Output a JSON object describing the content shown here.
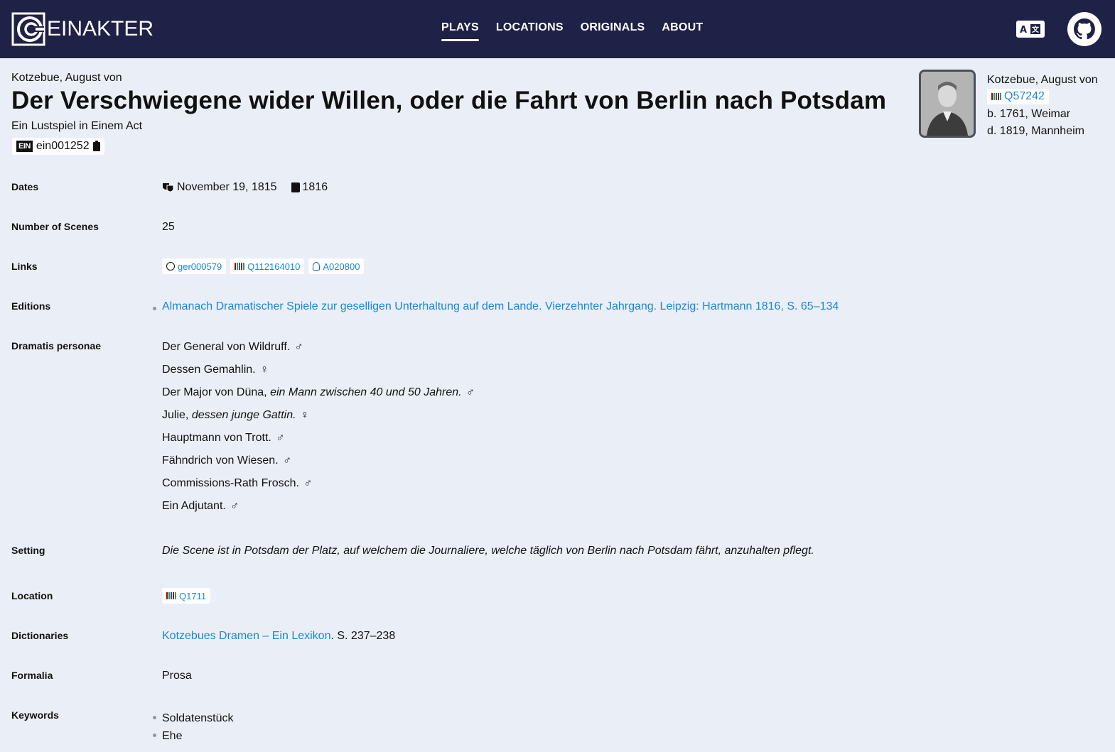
{
  "header": {
    "logo_text": "EINAKTER",
    "nav": [
      {
        "label": "PLAYS",
        "active": true
      },
      {
        "label": "LOCATIONS",
        "active": false
      },
      {
        "label": "ORIGINALS",
        "active": false
      },
      {
        "label": "ABOUT",
        "active": false
      }
    ],
    "icons": [
      "translate-icon",
      "github-icon"
    ],
    "colors": {
      "bar": "#1f2146",
      "link": "#1b86d9",
      "background": "#eaeff7"
    }
  },
  "play": {
    "author": "Kotzebue, August von",
    "title": "Der Verschwiegene wider Willen, oder die Fahrt von Berlin nach Potsdam",
    "subtitle": "Ein Lustspiel in Einem Act",
    "id_icon": "EIN",
    "id": "ein001252"
  },
  "author_card": {
    "name": "Kotzebue, August von",
    "wikidata": "Q57242",
    "born": "b. 1761, Weimar",
    "died": "d. 1819, Mannheim"
  },
  "details": {
    "dates": {
      "label": "Dates",
      "premiere": "November 19, 1815",
      "print": "1816"
    },
    "scenes": {
      "label": "Number of Scenes",
      "value": "25"
    },
    "links": {
      "label": "Links",
      "dracor": "ger000579",
      "wikidata": "Q112164010",
      "gnd": "A020800"
    },
    "editions": {
      "label": "Editions",
      "items": [
        "Almanach Dramatischer Spiele zur geselligen Unterhaltung auf dem Lande. Vierzehnter Jahrgang. Leipzig: Hartmann 1816, S. 65–134"
      ]
    },
    "dramatis": {
      "label": "Dramatis personae",
      "cast": [
        {
          "name": "Der General von Wildruff.",
          "desc": "",
          "gender": "♂"
        },
        {
          "name": "Dessen Gemahlin.",
          "desc": "",
          "gender": "♀"
        },
        {
          "name": "Der Major von Düna,",
          "desc": "ein Mann zwischen 40 und 50 Jahren.",
          "gender": "♂"
        },
        {
          "name": "Julie,",
          "desc": "dessen junge Gattin.",
          "gender": "♀"
        },
        {
          "name": "Hauptmann von Trott.",
          "desc": "",
          "gender": "♂"
        },
        {
          "name": "Fähndrich von Wiesen.",
          "desc": "",
          "gender": "♂"
        },
        {
          "name": "Commissions-Rath Frosch.",
          "desc": "",
          "gender": "♂"
        },
        {
          "name": "Ein Adjutant.",
          "desc": "",
          "gender": "♂"
        }
      ]
    },
    "setting": {
      "label": "Setting",
      "value": "Die Scene ist in Potsdam der Platz, auf welchem die Journaliere, welche täglich von Berlin nach Potsdam fährt, anzuhalten pflegt."
    },
    "location": {
      "label": "Location",
      "wikidata": "Q1711"
    },
    "dictionaries": {
      "label": "Dictionaries",
      "link": "Kotzebues Dramen – Ein Lexikon",
      "suffix": ". S. 237–238"
    },
    "formalia": {
      "label": "Formalia",
      "value": "Prosa"
    },
    "keywords": {
      "label": "Keywords",
      "items": [
        "Soldatenstück",
        "Ehe"
      ]
    }
  }
}
